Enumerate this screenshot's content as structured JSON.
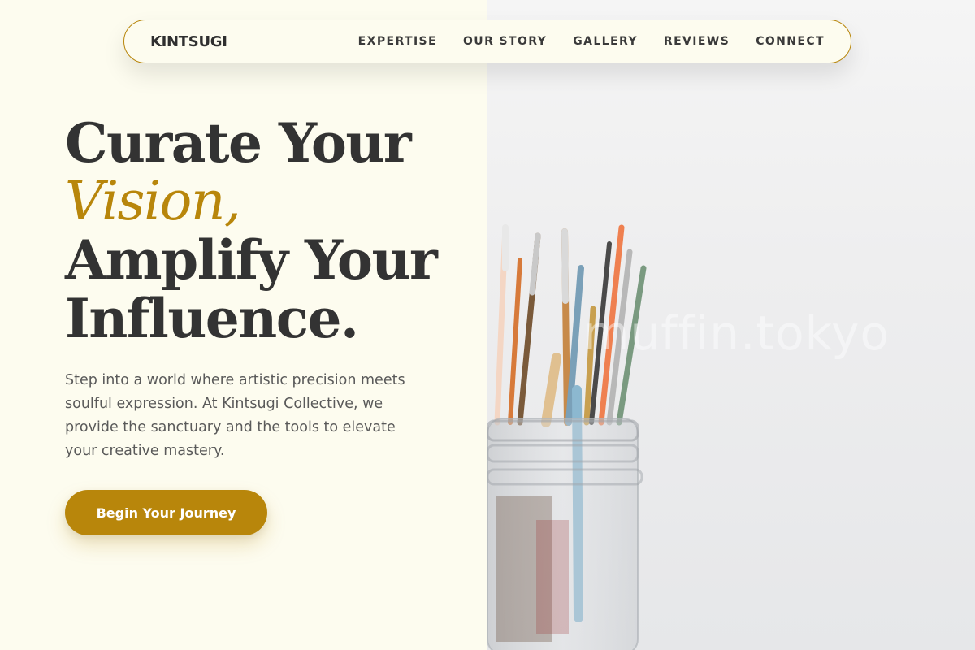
{
  "nav": {
    "logo": "KINTSUGI",
    "links": [
      "EXPERTISE",
      "OUR STORY",
      "GALLERY",
      "REVIEWS",
      "CONNECT"
    ]
  },
  "hero": {
    "title_line1": "Curate Your",
    "title_accent": "Vision,",
    "title_line3": "Amplify Your",
    "title_line4": "Influence.",
    "description": "Step into a world where artistic precision meets soulful expression. At Kintsugi Collective, we provide the sanctuary and the tools to elevate your creative mastery.",
    "cta_label": "Begin Your Journey"
  },
  "image": {
    "subject": "paint-brushes-in-glass-jar",
    "watermark": "muffin.tokyo"
  },
  "colors": {
    "accent": "#b8860b",
    "background": "#fdfcef",
    "heading": "#333333",
    "body_text": "#5a5a5a"
  }
}
